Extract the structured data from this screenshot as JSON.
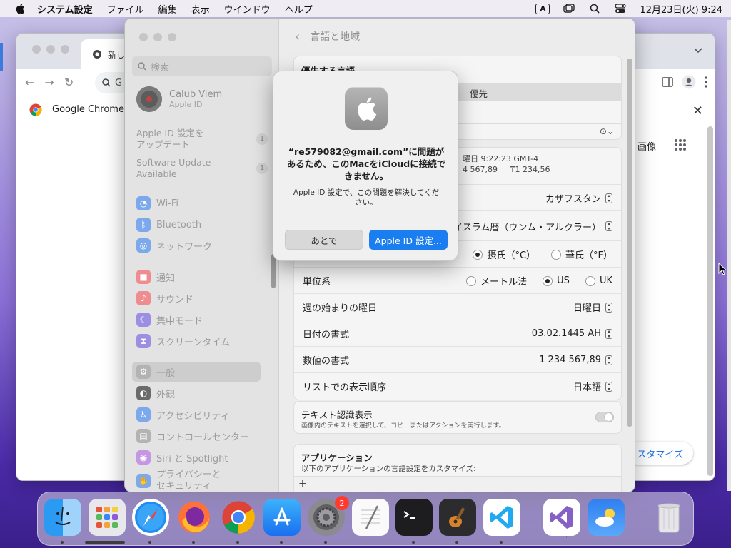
{
  "menubar": {
    "app_name": "システム設定",
    "menus": [
      "ファイル",
      "編集",
      "表示",
      "ウインドウ",
      "ヘルプ"
    ],
    "input_indicator": "A",
    "clock": "12月23日(火) 9:24"
  },
  "chrome": {
    "tab_title": "新し",
    "omnibox_text": "G",
    "bookmark_label": "Google Chrome",
    "images_link": "画像",
    "customize_button": "スタマイズ"
  },
  "settings": {
    "search_placeholder": "検索",
    "user": {
      "name": "Calub Viem",
      "sub": "Apple ID"
    },
    "updates": [
      {
        "label_line1": "Apple ID 設定を",
        "label_line2": "アップデート",
        "badge": "1"
      },
      {
        "label_line1": "Software Update",
        "label_line2": "Available",
        "badge": "1"
      }
    ],
    "sidebar_items": [
      {
        "label": "Wi-Fi",
        "icon": "wifi-icon",
        "color": "#3a86f7"
      },
      {
        "label": "Bluetooth",
        "icon": "bluetooth-icon",
        "color": "#3a86f7"
      },
      {
        "label": "ネットワーク",
        "icon": "network-icon",
        "color": "#3a86f7"
      },
      {
        "label": "通知",
        "icon": "notification-icon",
        "color": "#f0434c"
      },
      {
        "label": "サウンド",
        "icon": "sound-icon",
        "color": "#f0434c"
      },
      {
        "label": "集中モード",
        "icon": "focus-icon",
        "color": "#5a50d8"
      },
      {
        "label": "スクリーンタイム",
        "icon": "hourglass-icon",
        "color": "#5a50d8"
      },
      {
        "label": "一般",
        "icon": "gear-icon",
        "color": "#8e8e93"
      },
      {
        "label": "外観",
        "icon": "appearance-icon",
        "color": "#1d1d1f"
      },
      {
        "label": "アクセシビリティ",
        "icon": "accessibility-icon",
        "color": "#3a86f7"
      },
      {
        "label": "コントロールセンター",
        "icon": "control-center-icon",
        "color": "#8e8e93"
      },
      {
        "label": "Siri と Spotlight",
        "icon": "siri-icon",
        "color": "#a35ad6"
      },
      {
        "label": "プライバシーと",
        "label2": "セキュリティ",
        "icon": "privacy-icon",
        "color": "#3a86f7"
      }
    ],
    "page_title": "言語と地域",
    "preferred_section": {
      "title": "優先する言語",
      "primary_suffix": "優先"
    },
    "region_preview": {
      "line1": "曜日 9:22:23 GMT-4",
      "line2a": "4 567,89",
      "line2b": "₸1 234,56"
    },
    "rows": [
      {
        "label": "",
        "value": "カザフスタン"
      },
      {
        "label": "",
        "value": "イスラム暦（ウンム・アルクラー）"
      },
      {
        "label": "",
        "value": ""
      },
      {
        "label": "単位系",
        "value": ""
      },
      {
        "label": "週の始まりの曜日",
        "value": "日曜日"
      },
      {
        "label": "日付の書式",
        "value": "03.02.1445 AH"
      },
      {
        "label": "数値の書式",
        "value": "1 234 567,89"
      },
      {
        "label": "リストでの表示順序",
        "value": "日本語"
      }
    ],
    "temperature": {
      "celsius": "摂氏（°C）",
      "fahrenheit": "華氏（°F）"
    },
    "units": {
      "metric": "メートル法",
      "us": "US",
      "uk": "UK"
    },
    "live_text": {
      "title": "テキスト認識表示",
      "desc": "画像内のテキストを選択して、コピーまたはアクションを実行します。"
    },
    "applications": {
      "title": "アプリケーション",
      "desc": "以下のアプリケーションの言語設定をカスタマイズ:",
      "add": "+",
      "remove": "—"
    }
  },
  "dialog": {
    "title": "“re579082@gmail.com”に問題があるため、このMacをiCloudに接続できません。",
    "message": "Apple ID 設定で、この問題を解決してください。",
    "later": "あとで",
    "primary": "Apple ID 設定..."
  },
  "dock": {
    "apps": [
      {
        "name": "finder",
        "badge": ""
      },
      {
        "name": "launchpad",
        "badge": ""
      },
      {
        "name": "safari",
        "badge": ""
      },
      {
        "name": "firefox",
        "badge": ""
      },
      {
        "name": "chrome",
        "badge": ""
      },
      {
        "name": "app-store",
        "badge": ""
      },
      {
        "name": "system-settings",
        "badge": "2"
      },
      {
        "name": "textedit",
        "badge": ""
      },
      {
        "name": "terminal",
        "badge": ""
      },
      {
        "name": "garageband",
        "badge": ""
      },
      {
        "name": "vscode",
        "badge": ""
      },
      {
        "name": "visual-studio",
        "badge": ""
      },
      {
        "name": "weather",
        "badge": ""
      },
      {
        "name": "trash",
        "badge": ""
      }
    ]
  }
}
